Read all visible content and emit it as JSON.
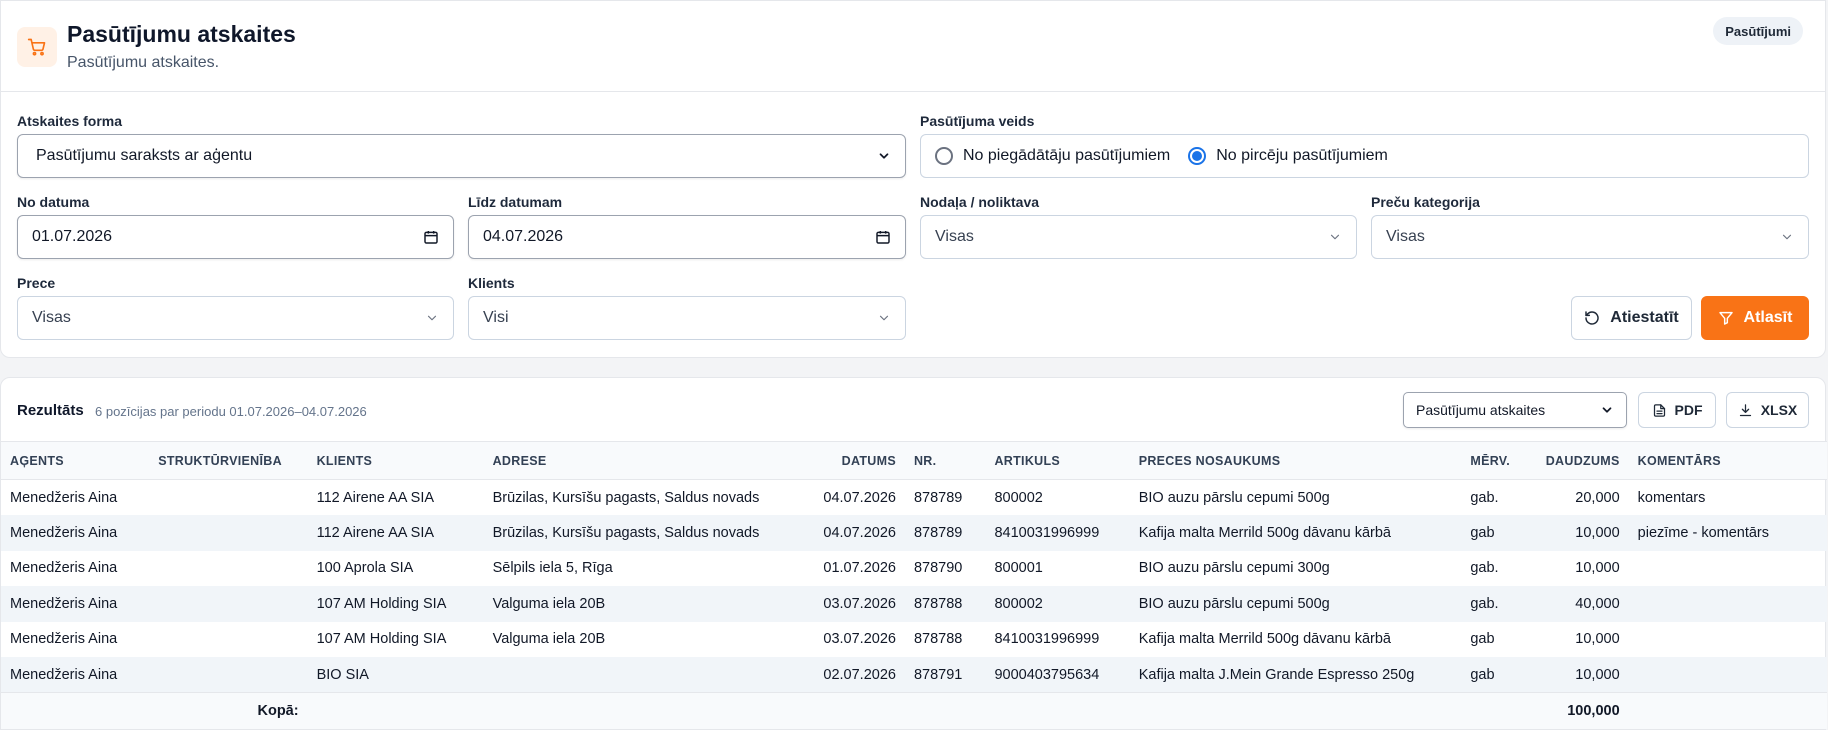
{
  "header": {
    "title": "Pasūtījumu atskaites",
    "subtitle": "Pasūtījumu atskaites.",
    "badge": "Pasūtījumi",
    "accent": "#f97316"
  },
  "filters": {
    "report_form": {
      "label": "Atskaites forma",
      "value": "Pasūtījumu saraksts ar aģentu"
    },
    "order_type": {
      "label": "Pasūtījuma veids",
      "options": [
        {
          "label": "No piegādātāju pasūtījumiem",
          "selected": false
        },
        {
          "label": "No pircēju pasūtījumiem",
          "selected": true
        }
      ]
    },
    "date_from": {
      "label": "No datuma",
      "value": "01.07.2026"
    },
    "date_to": {
      "label": "Līdz datumam",
      "value": "04.07.2026"
    },
    "department": {
      "label": "Nodaļa / noliktava",
      "value": "Visas"
    },
    "category": {
      "label": "Preču kategorija",
      "value": "Visas"
    },
    "product": {
      "label": "Prece",
      "value": "Visas"
    },
    "client": {
      "label": "Klients",
      "value": "Visi"
    },
    "reset_label": "Atiestatīt",
    "filter_label": "Atlasīt"
  },
  "results": {
    "title": "Rezultāts",
    "summary": "6 pozīcijas par periodu 01.07.2026–04.07.2026",
    "report_select": "Pasūtījumu atskaites",
    "pdf_label": "PDF",
    "xlsx_label": "XLSX",
    "columns": [
      "AĢENTS",
      "STRUKTŪRVIENĪBA",
      "KLIENTS",
      "ADRESE",
      "DATUMS",
      "NR.",
      "ARTIKULS",
      "PRECES NOSAUKUMS",
      "MĒRV.",
      "DAUDZUMS",
      "KOMENTĀRS"
    ],
    "rows": [
      [
        "Menedžeris Aina",
        "",
        "112 Airene AA SIA",
        "Brūzilas, Kursīšu pagasts, Saldus novads",
        "04.07.2026",
        "878789",
        "800002",
        "BIO auzu pārslu cepumi 500g",
        "gab.",
        "20,000",
        "komentars"
      ],
      [
        "Menedžeris Aina",
        "",
        "112 Airene AA SIA",
        "Brūzilas, Kursīšu pagasts, Saldus novads",
        "04.07.2026",
        "878789",
        "8410031996999",
        "Kafija malta Merrild 500g dāvanu kārbā",
        "gab",
        "10,000",
        "piezīme - komentārs"
      ],
      [
        "Menedžeris Aina",
        "",
        "100 Aprola SIA",
        "Sēlpils iela 5, Rīga",
        "01.07.2026",
        "878790",
        "800001",
        "BIO auzu pārslu cepumi 300g",
        "gab.",
        "10,000",
        ""
      ],
      [
        "Menedžeris Aina",
        "",
        "107 AM Holding SIA",
        "Valguma iela 20B",
        "03.07.2026",
        "878788",
        "800002",
        "BIO auzu pārslu cepumi 500g",
        "gab.",
        "40,000",
        ""
      ],
      [
        "Menedžeris Aina",
        "",
        "107 AM Holding SIA",
        "Valguma iela 20B",
        "03.07.2026",
        "878788",
        "8410031996999",
        "Kafija malta Merrild 500g dāvanu kārbā",
        "gab",
        "10,000",
        ""
      ],
      [
        "Menedžeris Aina",
        "",
        "BIO SIA",
        "",
        "02.07.2026",
        "878791",
        "9000403795634",
        "Kafija malta J.Mein Grande Espresso 250g",
        "gab",
        "10,000",
        ""
      ]
    ],
    "total_label": "Kopā:",
    "total_value": "100,000"
  }
}
